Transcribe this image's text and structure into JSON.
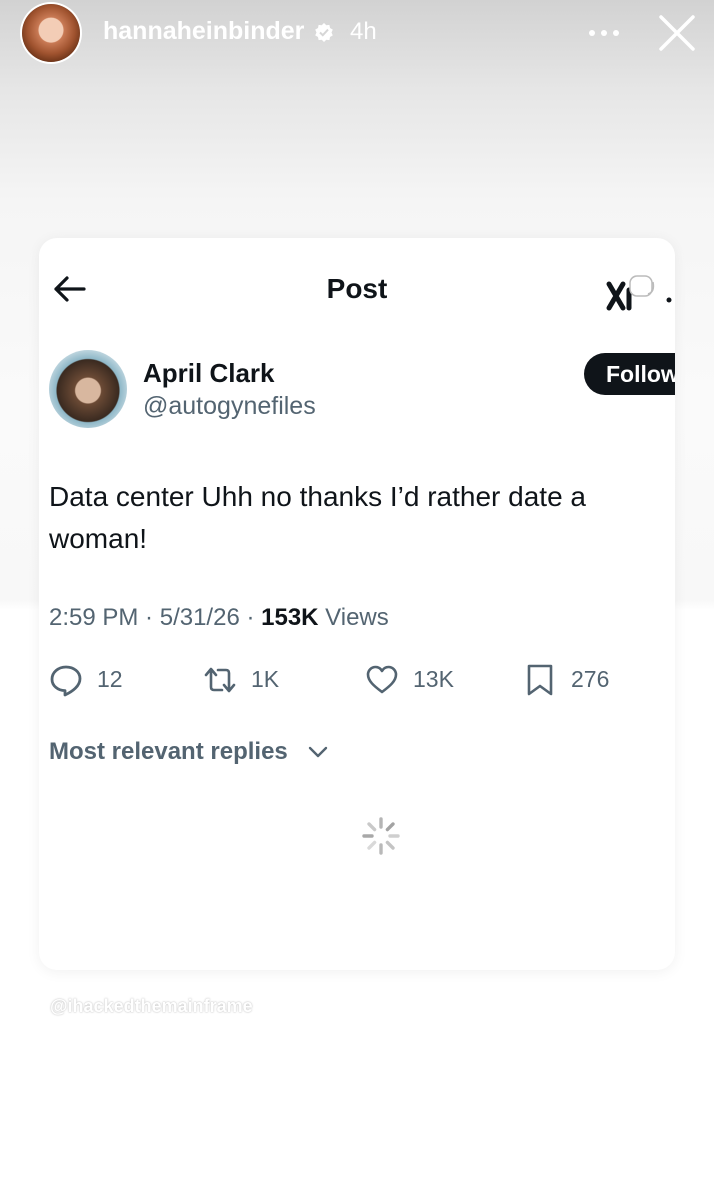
{
  "story": {
    "username": "hannaheinbinder",
    "time": "4h",
    "icons": [
      "verified-icon",
      "more-icon",
      "close-icon"
    ]
  },
  "post": {
    "header_title": "Post",
    "author": {
      "name": "April Clark",
      "handle": "@autogynefiles"
    },
    "follow_label": "Follow",
    "text": "Data center Uhh no thanks I’d rather date a woman!",
    "meta": {
      "time": "2:59 PM",
      "date": "5/31/26",
      "views_count": "153K",
      "views_label": "Views"
    },
    "actions": {
      "replies": "12",
      "reposts": "1K",
      "likes": "13K",
      "bookmarks": "276"
    },
    "replies_sort": "Most relevant replies"
  },
  "watermark": "@ihackedthemainframe",
  "colors": {
    "text_primary": "#0f1419",
    "text_secondary": "#536471",
    "follow_bg": "#0f1419"
  }
}
